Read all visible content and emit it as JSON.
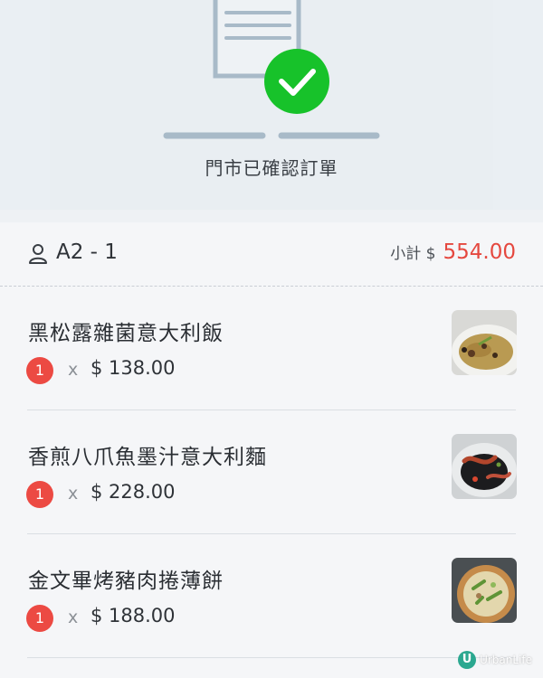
{
  "confirmation": {
    "message": "門市已確認訂單",
    "check_color": "#17c22a"
  },
  "order": {
    "table_label": "A2 - 1",
    "subtotal_label": "小計 $",
    "subtotal_value": "554.00",
    "items": [
      {
        "name": "黑松露雜菌意大利飯",
        "qty": "1",
        "times": "x",
        "price": "$ 138.00"
      },
      {
        "name": "香煎八爪魚墨汁意大利麵",
        "qty": "1",
        "times": "x",
        "price": "$ 228.00"
      },
      {
        "name": "金文畢烤豬肉捲薄餅",
        "qty": "1",
        "times": "x",
        "price": "$ 188.00"
      }
    ]
  },
  "watermark": {
    "text": "UrbanLife"
  },
  "colors": {
    "accent_red": "#e5483f",
    "badge_red": "#ec4a43"
  }
}
